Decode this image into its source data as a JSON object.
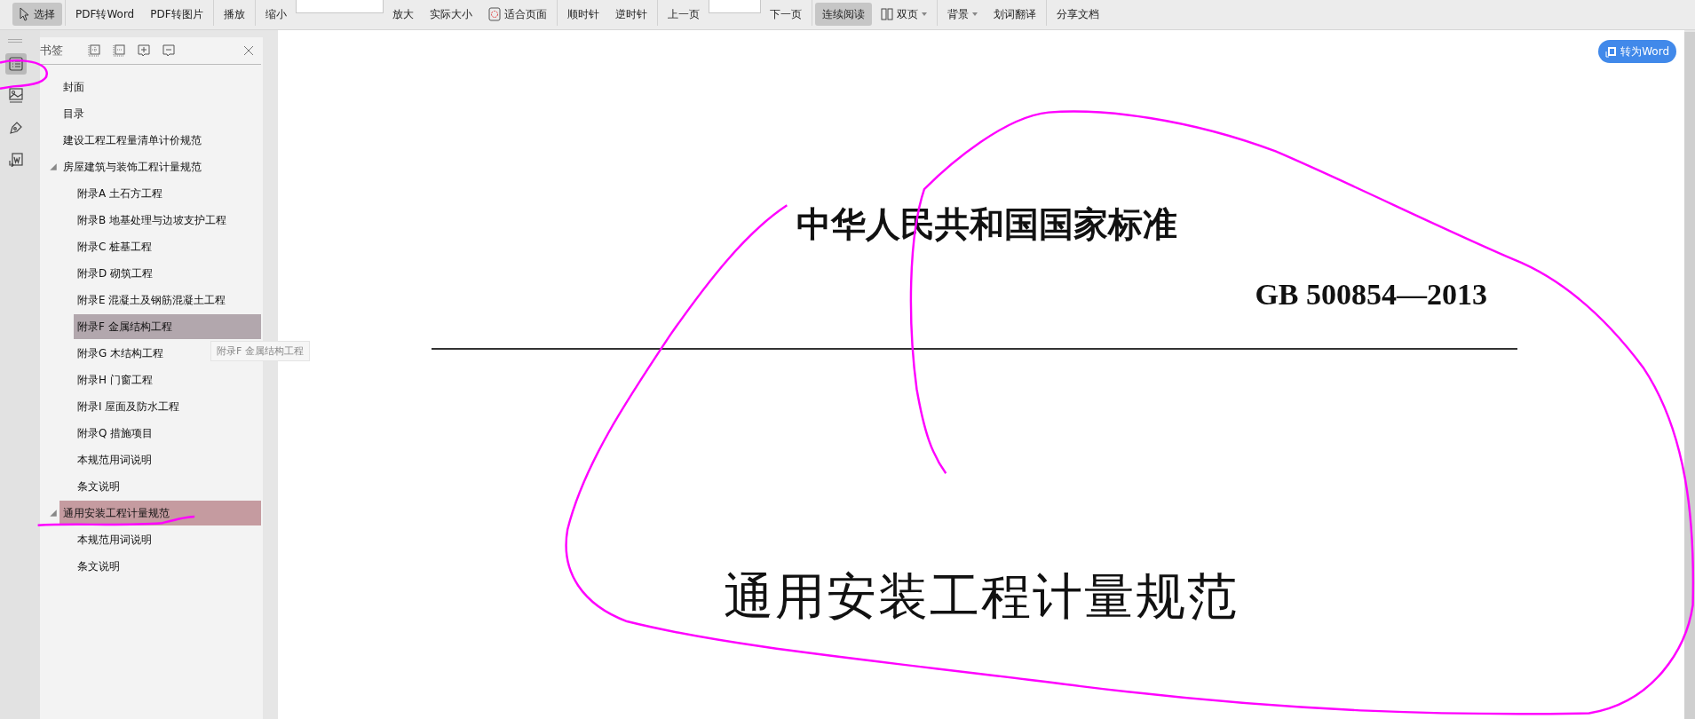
{
  "toolbar": [
    {
      "kind": "button",
      "label": "选择",
      "selected": true
    },
    {
      "kind": "separator"
    },
    {
      "kind": "button",
      "label": "PDF转Word",
      "selected": false
    },
    {
      "kind": "button",
      "label": "PDF转图片",
      "selected": false
    },
    {
      "kind": "separator"
    },
    {
      "kind": "button",
      "label": "播放",
      "selected": false
    },
    {
      "kind": "separator"
    },
    {
      "kind": "button",
      "label": "缩小",
      "selected": false
    },
    {
      "kind": "field"
    },
    {
      "kind": "button",
      "label": "放大",
      "selected": false
    },
    {
      "kind": "button",
      "label": "实际大小",
      "selected": false
    },
    {
      "kind": "button",
      "label": "适合页面",
      "selected": false
    },
    {
      "kind": "separator"
    },
    {
      "kind": "button",
      "label": "顺时针",
      "selected": false
    },
    {
      "kind": "button",
      "label": "逆时针",
      "selected": false
    },
    {
      "kind": "separator"
    },
    {
      "kind": "button",
      "label": "上一页",
      "selected": false
    },
    {
      "kind": "field"
    },
    {
      "kind": "button",
      "label": "下一页",
      "selected": false
    },
    {
      "kind": "separator"
    },
    {
      "kind": "button",
      "label": "连续阅读",
      "selected": true
    },
    {
      "kind": "button",
      "label": "双页",
      "selected": false,
      "dropdown": true
    },
    {
      "kind": "separator"
    },
    {
      "kind": "button",
      "label": "背景",
      "selected": false,
      "dropdown": true
    },
    {
      "kind": "button",
      "label": "划词翻译",
      "selected": false
    },
    {
      "kind": "separator"
    },
    {
      "kind": "button",
      "label": "分享文档",
      "selected": false
    }
  ],
  "rail": [
    {
      "selected": true
    },
    {
      "selected": false
    },
    {
      "selected": false
    },
    {
      "selected": false
    }
  ],
  "sidebar": {
    "title": "书签",
    "bookmarks": [
      {
        "label": "封面",
        "selected": false,
        "highlighted": false
      },
      {
        "label": "目录",
        "selected": false,
        "highlighted": false
      },
      {
        "label": "建设工程工程量清单计价规范",
        "selected": false,
        "highlighted": false
      },
      {
        "label": "房屋建筑与装饰工程计量规范",
        "selected": false,
        "highlighted": false,
        "expanded": true,
        "children": [
          {
            "label": "附录A 土石方工程",
            "selected": false,
            "highlighted": false
          },
          {
            "label": "附录B 地基处理与边坡支护工程",
            "selected": false,
            "highlighted": false
          },
          {
            "label": "附录C 桩基工程",
            "selected": false,
            "highlighted": false
          },
          {
            "label": "附录D 砌筑工程",
            "selected": false,
            "highlighted": false
          },
          {
            "label": "附录E 混凝土及钢筋混凝土工程",
            "selected": false,
            "highlighted": false
          },
          {
            "label": "附录F 金属结构工程",
            "selected": false,
            "highlighted": true
          },
          {
            "label": "附录G 木结构工程",
            "selected": false,
            "highlighted": false
          },
          {
            "label": "附录H 门窗工程",
            "selected": false,
            "highlighted": false
          },
          {
            "label": "附录I 屋面及防水工程",
            "selected": false,
            "highlighted": false
          },
          {
            "label": "附录Q 措施项目",
            "selected": false,
            "highlighted": false
          },
          {
            "label": "本规范用词说明",
            "selected": false,
            "highlighted": false
          },
          {
            "label": "条文说明",
            "selected": false,
            "highlighted": false
          }
        ]
      },
      {
        "label": "通用安装工程计量规范",
        "selected": true,
        "expanded": true,
        "children": [
          {
            "label": "本规范用词说明",
            "selected": false,
            "highlighted": false
          },
          {
            "label": "条文说明",
            "selected": false,
            "highlighted": false
          }
        ]
      }
    ],
    "tooltip": "附录F 金属结构工程"
  },
  "document": {
    "convert_button": "转为Word",
    "heading": "中华人民共和国国家标准",
    "code": "GB 500854—2013",
    "title": "通用安装工程计量规范"
  }
}
